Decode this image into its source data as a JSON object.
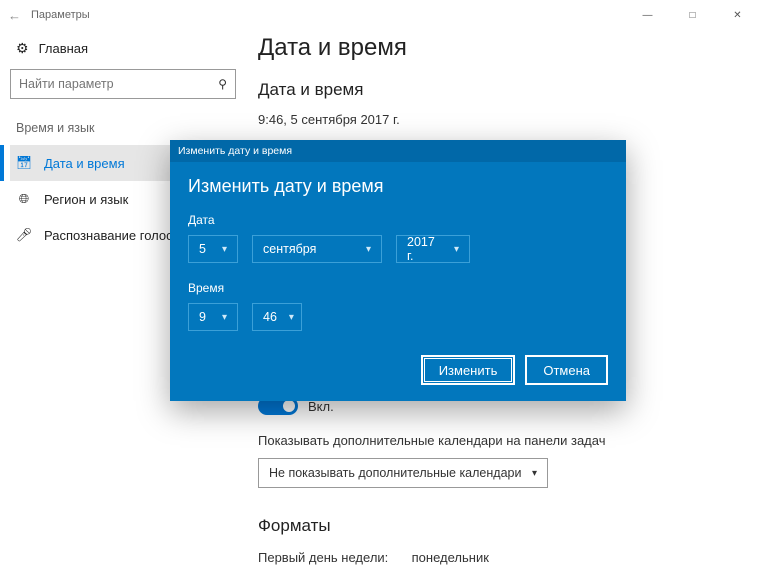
{
  "window": {
    "title": "Параметры"
  },
  "sidebar": {
    "home": "Главная",
    "search_placeholder": "Найти параметр",
    "category": "Время и язык",
    "items": [
      {
        "label": "Дата и время"
      },
      {
        "label": "Регион и язык"
      },
      {
        "label": "Распознавание голоса"
      }
    ]
  },
  "main": {
    "page_title": "Дата и время",
    "section_title": "Дата и время",
    "current_datetime": "9:46, 5 сентября 2017 г.",
    "switch_on": "Вкл.",
    "extra_calendars_label": "Показывать дополнительные календари на панели задач",
    "extra_calendars_value": "Не показывать дополнительные календари",
    "formats_title": "Форматы",
    "first_day_label": "Первый день недели:",
    "first_day_value": "понедельник"
  },
  "dialog": {
    "titlebar": "Изменить дату и время",
    "title": "Изменить дату и время",
    "date_label": "Дата",
    "date_day": "5",
    "date_month": "сентября",
    "date_year": "2017 г.",
    "time_label": "Время",
    "time_hour": "9",
    "time_minute": "46",
    "apply": "Изменить",
    "cancel": "Отмена"
  }
}
